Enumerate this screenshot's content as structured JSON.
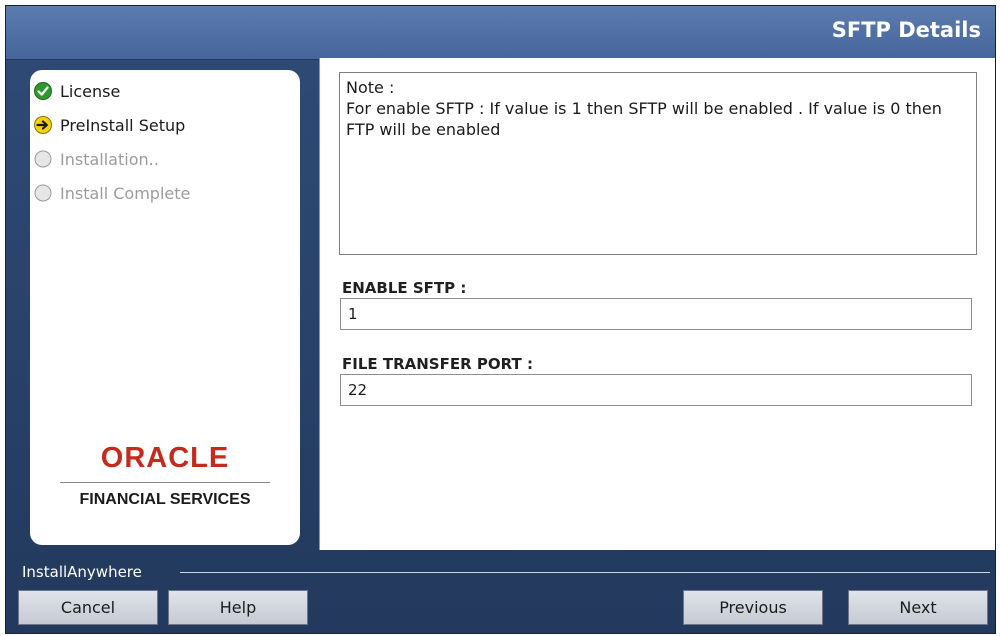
{
  "header": {
    "title": "SFTP Details"
  },
  "steps": [
    {
      "label": "License",
      "state": "done",
      "icon": "check-circle-icon"
    },
    {
      "label": "PreInstall Setup",
      "state": "current",
      "icon": "arrow-circle-icon"
    },
    {
      "label": "Installation..",
      "state": "pending",
      "icon": "empty-circle-icon"
    },
    {
      "label": "Install Complete",
      "state": "pending",
      "icon": "empty-circle-icon"
    }
  ],
  "logo": {
    "brand": "ORACLE",
    "subtitle": "FINANCIAL SERVICES"
  },
  "note": {
    "heading": "Note :",
    "body": "For enable SFTP : If value is 1 then SFTP will be enabled . If value is 0 then FTP will be enabled"
  },
  "fields": {
    "enable_sftp": {
      "label": "ENABLE SFTP :",
      "value": "1"
    },
    "file_transfer_port": {
      "label": "FILE TRANSFER PORT :",
      "value": "22"
    }
  },
  "footer": {
    "product": "InstallAnywhere",
    "cancel_label": "Cancel",
    "help_label": "Help",
    "previous_label": "Previous",
    "next_label": "Next"
  },
  "colors": {
    "header": "#4f6fa4",
    "background": "#2a4268",
    "oracle_red": "#c52a1e",
    "done_green": "#2e9a2e",
    "current_yellow": "#f2d20f"
  }
}
